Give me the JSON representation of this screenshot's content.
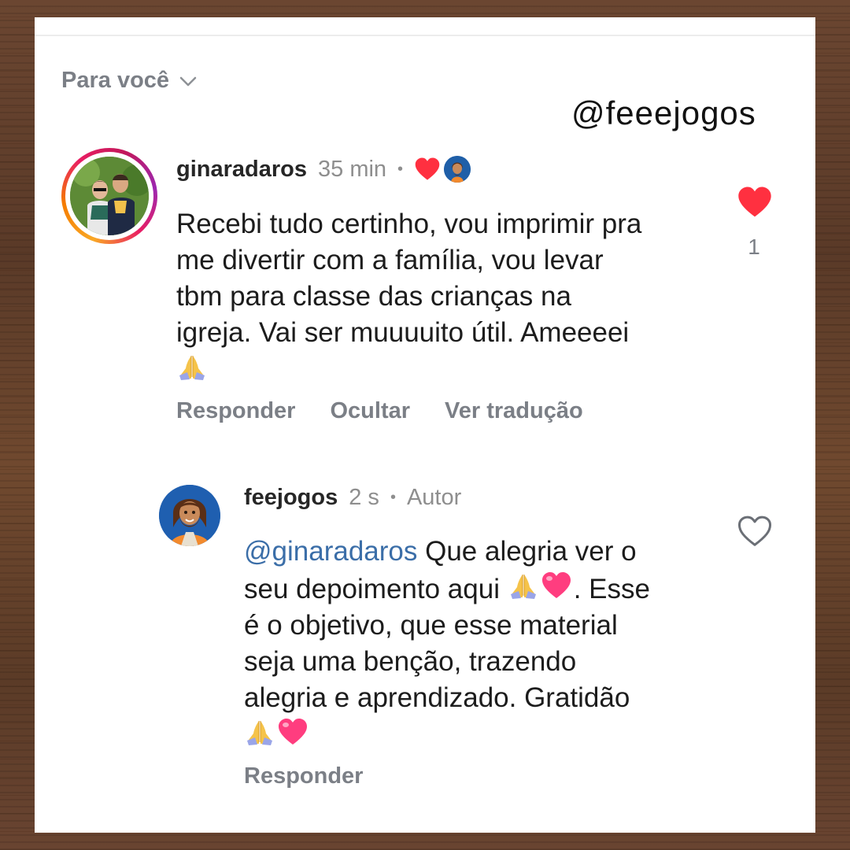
{
  "feed_filter": {
    "label": "Para você"
  },
  "watermark": {
    "handle": "@feeejogos"
  },
  "comments": [
    {
      "author": "ginaradaros",
      "time": "35 min",
      "separator": "•",
      "text_lines": [
        "Recebi tudo certinho, vou imprimir pra",
        "me divertir com a família, vou levar",
        "tbm para classe das crianças na",
        "igreja. Vai ser muuuuito útil.  Ameeeei"
      ],
      "likes": "1",
      "actions": [
        "Responder",
        "Ocultar",
        "Ver tradução"
      ]
    },
    {
      "author": "feejogos",
      "time": "2 s",
      "separator": "•",
      "badge": "Autor",
      "mention": "@ginaradaros",
      "text_first": " Que alegria ver o",
      "text_line2": "seu depoimento aqui ",
      "text_line2_end": ". Esse",
      "text_lines_rest": [
        "é o objetivo, que esse material",
        "seja uma benção, trazendo",
        "alegria e aprendizado. Gratidão"
      ],
      "actions": [
        "Responder"
      ]
    }
  ],
  "colors": {
    "like_red": "#ff3040",
    "mention_blue": "#3b6ea8",
    "muted_gray": "#7b7f86"
  },
  "icons": [
    "chevron-down-icon",
    "heart-icon",
    "jesus-avatar-icon",
    "praying-hands-icon",
    "pink-heart-icon",
    "heart-outline-icon"
  ]
}
